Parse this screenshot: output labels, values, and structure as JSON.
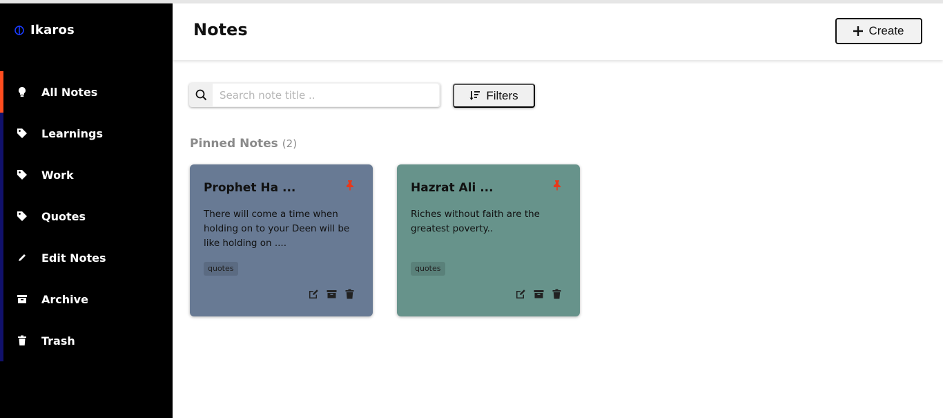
{
  "app": {
    "brand": "Ikaros"
  },
  "sidebar": {
    "items": [
      {
        "label": "All Notes",
        "icon": "lightbulb-icon"
      },
      {
        "label": "Learnings",
        "icon": "tag-icon"
      },
      {
        "label": "Work",
        "icon": "tag-icon"
      },
      {
        "label": "Quotes",
        "icon": "tag-icon"
      },
      {
        "label": "Edit Notes",
        "icon": "pencil-icon"
      },
      {
        "label": "Archive",
        "icon": "archive-icon"
      },
      {
        "label": "Trash",
        "icon": "trash-icon"
      }
    ],
    "active_index": 0
  },
  "header": {
    "title": "Notes",
    "create_label": "Create"
  },
  "search": {
    "placeholder": "Search note title .."
  },
  "filters": {
    "label": "Filters"
  },
  "pinned": {
    "label": "Pinned Notes",
    "count": "(2)",
    "notes": [
      {
        "title": "Prophet Ha ...",
        "body": "There will come a time when holding on to your Deen will be like holding on ....",
        "tag": "quotes",
        "color": "#687a94"
      },
      {
        "title": "Hazrat Ali ...",
        "body": "Riches without faith are the greatest poverty..",
        "tag": "quotes",
        "color": "#67938b"
      }
    ]
  },
  "colors": {
    "sidebar_bg": "#000000",
    "active_accent": "#ff4d1f",
    "nav_accent": "#11116b",
    "pin": "#e8381a"
  }
}
